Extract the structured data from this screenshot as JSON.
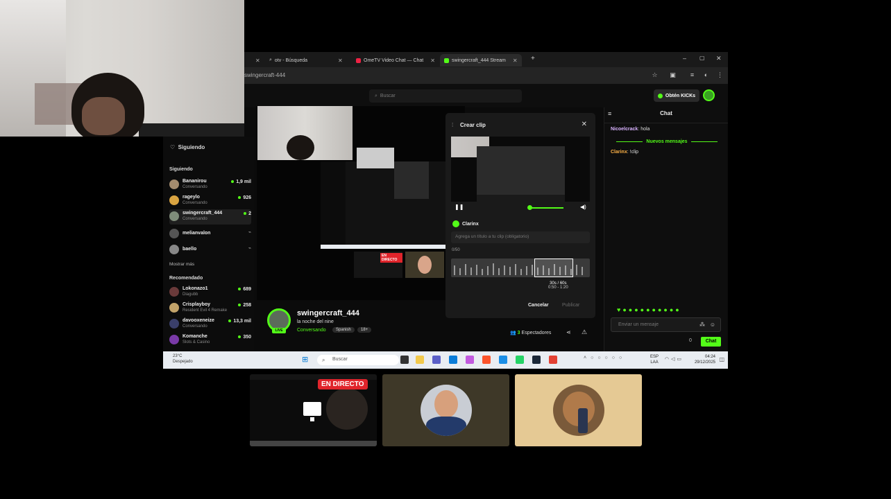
{
  "browser": {
    "tabs": [
      {
        "label": "",
        "close": "✕"
      },
      {
        "label": "otv - Búsqueda",
        "close": "✕"
      },
      {
        "label": "OmeTV Video Chat — Chat",
        "close": "✕"
      },
      {
        "label": "swingercraft_444 Stream",
        "close": "✕"
      }
    ],
    "new_tab": "+",
    "url": "swingercraft-444"
  },
  "kick": {
    "search_placeholder": "Buscar",
    "kicks_button": "Obtén KICKs"
  },
  "sidebar": {
    "following_header": "Siguiendo",
    "following_section": "Siguiendo",
    "following": [
      {
        "name": "Bananirou",
        "category": "Conversando",
        "viewers": "1,9 mil"
      },
      {
        "name": "rageylo",
        "category": "Conversando",
        "viewers": "926"
      },
      {
        "name": "swingercraft_444",
        "category": "Conversando",
        "viewers": "2"
      },
      {
        "name": "melianvalon",
        "category": "",
        "viewers": ""
      },
      {
        "name": "baello",
        "category": "",
        "viewers": ""
      }
    ],
    "show_more": "Mostrar más",
    "recommended_section": "Recomendado",
    "recommended": [
      {
        "name": "Lokonazo1",
        "category": "Diagubb",
        "viewers": "689"
      },
      {
        "name": "Crisplayboy",
        "category": "Resident Evil 4 Remake",
        "viewers": "258"
      },
      {
        "name": "davooxeneize",
        "category": "Conversando",
        "viewers": "13,3 mil"
      },
      {
        "name": "Komanche",
        "category": "Slots & Casino",
        "viewers": "350"
      }
    ]
  },
  "nested_live_label": "EN DIRECTO",
  "clip_modal": {
    "title": "Crear clip",
    "close": "✕",
    "user": "Clarinx",
    "title_placeholder": "Agrega un título a tu clip (obligatorio)",
    "char_count": "0/50",
    "duration": "30s / 60s",
    "range": "0:50 - 1:20",
    "cancel": "Cancelar",
    "publish": "Publicar"
  },
  "stream_info": {
    "name": "swingercraft_444",
    "title": "la noche del nine",
    "category": "Conversando",
    "tags": [
      "Spanish",
      "18+"
    ],
    "live_badge": "LIVE",
    "viewers_count": "3",
    "viewers_label": "Espectadores"
  },
  "chat": {
    "header": "Chat",
    "messages": [
      {
        "user": "Nicoelcrack",
        "text": "hola"
      },
      {
        "user": "Clarinx",
        "text": "!clip"
      }
    ],
    "new_messages_label": "Nuevos mensajes",
    "input_placeholder": "Enviar un mensaje",
    "indicator": "0",
    "send_button": "Chat"
  },
  "taskbar": {
    "temp": "23°C",
    "weather": "Despejado",
    "search_placeholder": "Buscar",
    "lang_top": "ESP",
    "lang_bottom": "LAA",
    "time": "04:24",
    "date": "29/12/2025"
  },
  "participants": {
    "live_badge": "EN DIRECTO"
  },
  "colors": {
    "accent": "#53fc18",
    "live_red": "#e0242b"
  }
}
